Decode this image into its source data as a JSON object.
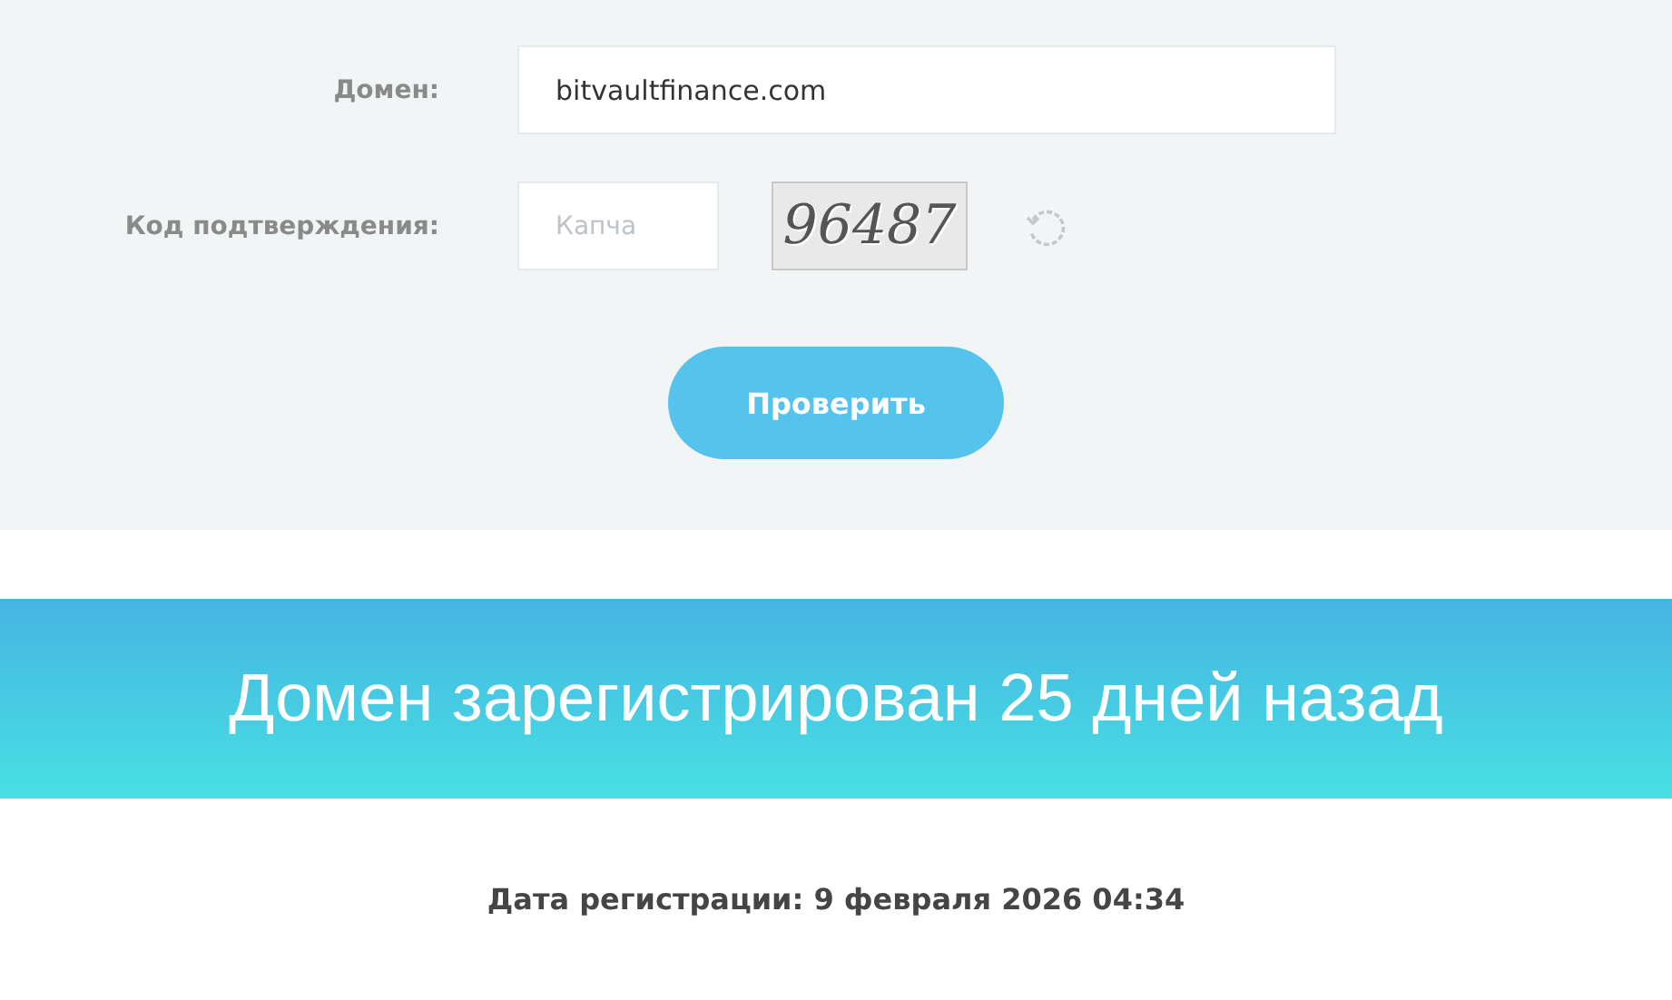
{
  "form": {
    "domain": {
      "label": "Домен:",
      "value": "bitvaultfinance.com"
    },
    "captcha": {
      "label": "Код подтверждения:",
      "placeholder": "Капча",
      "code": "96487"
    },
    "submit": "Проверить"
  },
  "result": {
    "headline": "Домен зарегистрирован 25 дней назад",
    "registration": "Дата регистрации: 9 февраля 2026 04:34"
  }
}
